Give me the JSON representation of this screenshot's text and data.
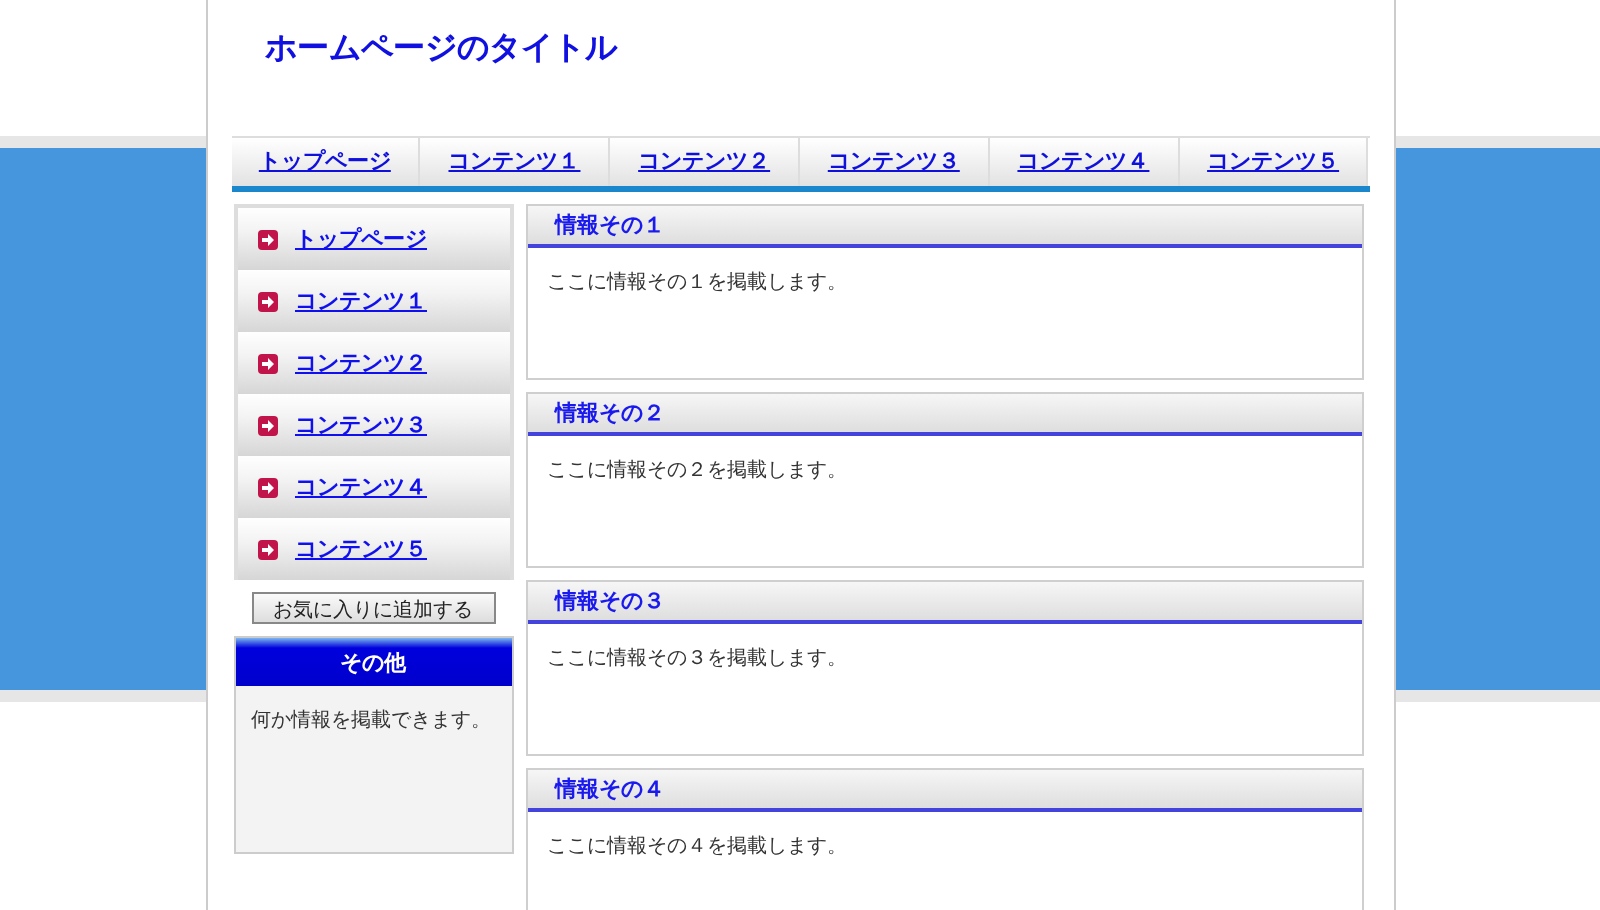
{
  "site_title": "ホームページのタイトル",
  "nav": [
    {
      "label": "トップページ"
    },
    {
      "label": "コンテンツ１"
    },
    {
      "label": "コンテンツ２"
    },
    {
      "label": "コンテンツ３"
    },
    {
      "label": "コンテンツ４"
    },
    {
      "label": "コンテンツ５"
    }
  ],
  "side_menu": [
    {
      "label": "トップページ"
    },
    {
      "label": "コンテンツ１"
    },
    {
      "label": "コンテンツ２"
    },
    {
      "label": "コンテンツ３"
    },
    {
      "label": "コンテンツ４"
    },
    {
      "label": "コンテンツ５"
    }
  ],
  "bookmark_button": "お気に入りに追加する",
  "other_box": {
    "title": "その他",
    "text": "何か情報を掲載できます。"
  },
  "panels": [
    {
      "title": "情報その１",
      "text": "ここに情報その１を掲載します。"
    },
    {
      "title": "情報その２",
      "text": "ここに情報その２を掲載します。"
    },
    {
      "title": "情報その３",
      "text": "ここに情報その３を掲載します。"
    },
    {
      "title": "情報その４",
      "text": "ここに情報その４を掲載します。"
    }
  ]
}
